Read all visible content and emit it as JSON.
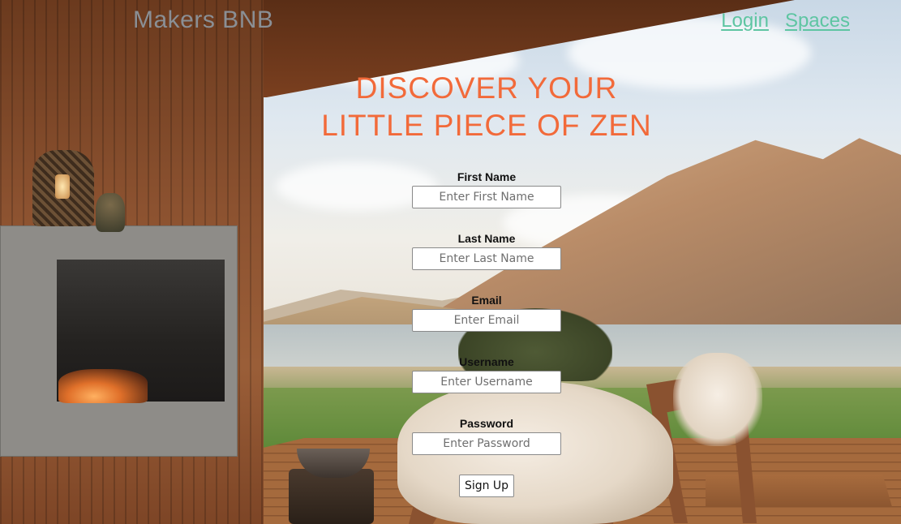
{
  "header": {
    "brand": "Makers BNB",
    "nav": [
      {
        "label": "Login"
      },
      {
        "label": "Spaces"
      }
    ]
  },
  "hero": {
    "line1": "DISCOVER YOUR",
    "line2": "LITTLE PIECE OF ZEN"
  },
  "form": {
    "fields": [
      {
        "label": "First Name",
        "placeholder": "Enter First Name"
      },
      {
        "label": "Last Name",
        "placeholder": "Enter Last Name"
      },
      {
        "label": "Email",
        "placeholder": "Enter Email"
      },
      {
        "label": "Username",
        "placeholder": "Enter Username"
      },
      {
        "label": "Password",
        "placeholder": "Enter Password"
      }
    ],
    "submit_label": "Sign Up"
  },
  "colors": {
    "brand_text": "#8a8f95",
    "nav_link": "#5ec5a2",
    "headline": "#f26a3a"
  },
  "background": {
    "icon": "outdoor-patio-mountain-lake-photo"
  }
}
